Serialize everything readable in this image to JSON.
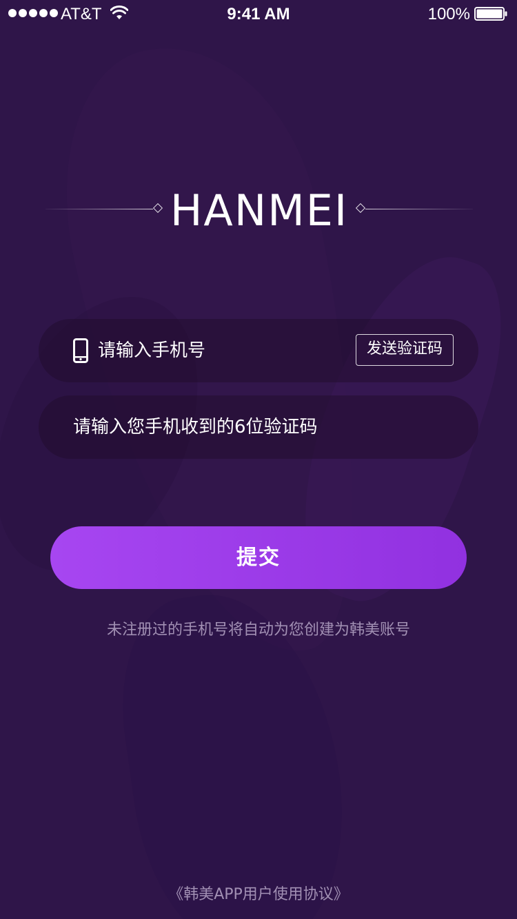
{
  "status_bar": {
    "carrier": "AT&T",
    "time": "9:41 AM",
    "battery": "100%",
    "signal_icon": "signal-dots-icon",
    "wifi_icon": "wifi-icon",
    "battery_icon": "battery-icon"
  },
  "logo": {
    "text": "HANMEI"
  },
  "form": {
    "phone_placeholder": "请输入手机号",
    "phone_icon": "phone-icon",
    "send_code_label": "发送验证码",
    "code_placeholder": "请输入您手机收到的6位验证码",
    "submit_label": "提交"
  },
  "hint": "未注册过的手机号将自动为您创建为韩美账号",
  "agreement": "《韩美APP用户使用协议》",
  "colors": {
    "background": "#2f1549",
    "button_gradient_start": "#a746f1",
    "button_gradient_end": "#9131e0",
    "muted_text": "#c8b9d7"
  }
}
